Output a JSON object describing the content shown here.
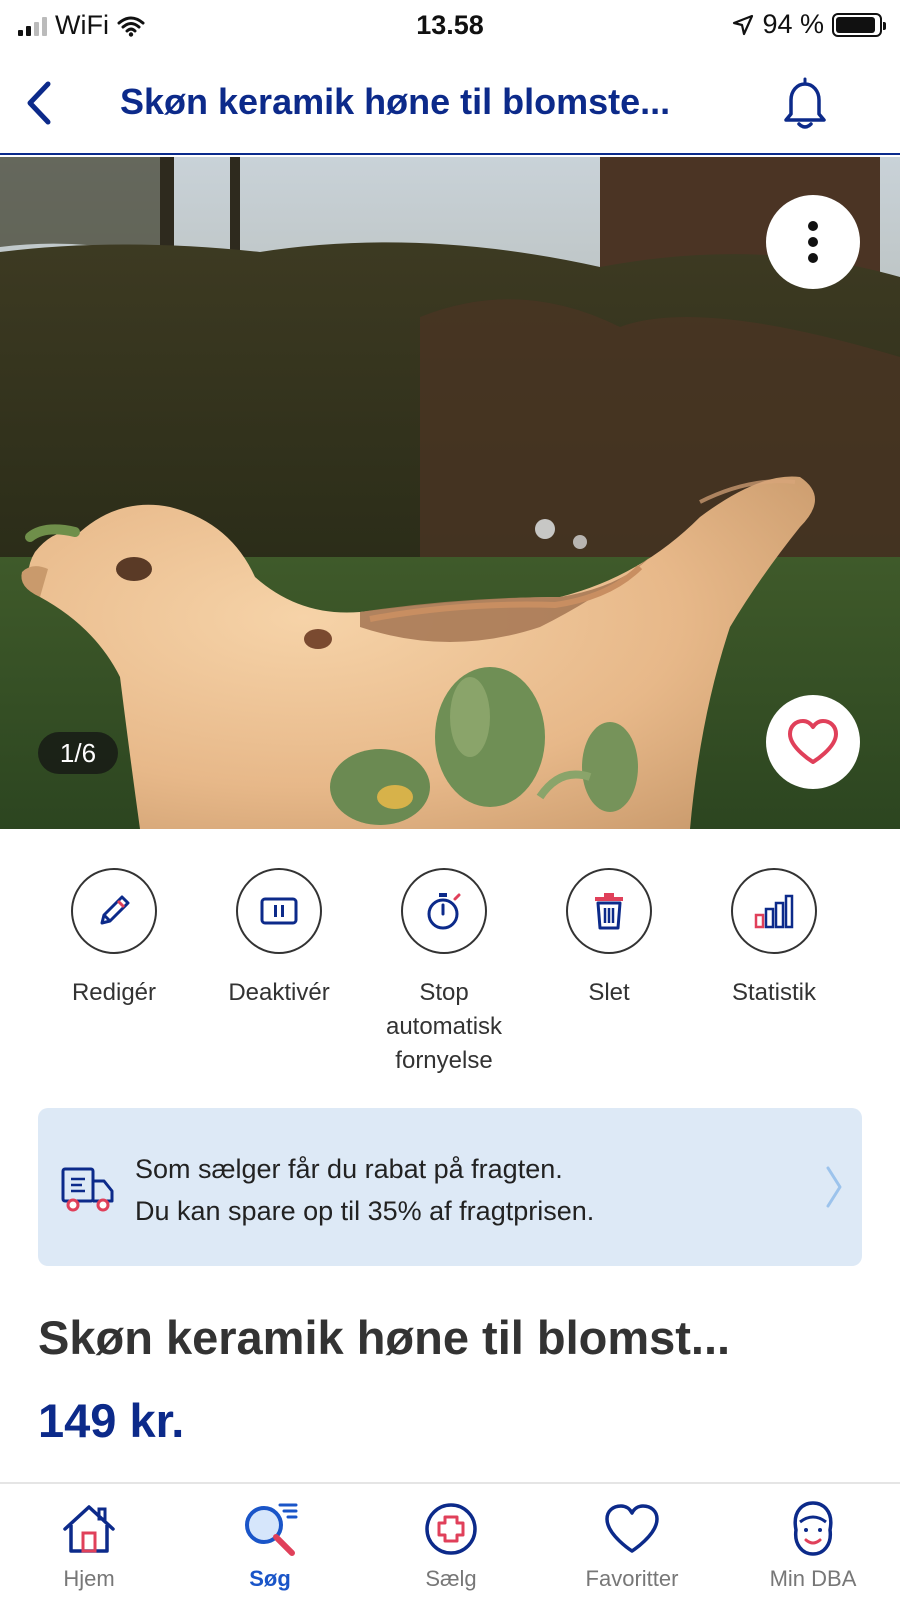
{
  "status_bar": {
    "carrier": "WiFi",
    "time": "13.58",
    "battery_text": "94 %",
    "battery_level": 0.94
  },
  "nav": {
    "title": "Skøn keramik høne til blomste..."
  },
  "gallery": {
    "counter": "1/6"
  },
  "actions": [
    {
      "label": "Redigér",
      "icon": "pencil-icon"
    },
    {
      "label": "Deaktivér",
      "icon": "pause-icon"
    },
    {
      "label": "Stop automatisk fornyelse",
      "icon": "stopwatch-icon"
    },
    {
      "label": "Slet",
      "icon": "trash-icon"
    },
    {
      "label": "Statistik",
      "icon": "bar-chart-icon"
    }
  ],
  "shipping_banner": {
    "line1": "Som sælger får du rabat på fragten.",
    "line2": "Du kan spare op til 35% af fragtprisen.",
    "icon": "delivery-truck-icon"
  },
  "listing": {
    "title": "Skøn keramik høne til blomst...",
    "price": "149 kr."
  },
  "tabbar": {
    "items": [
      {
        "label": "Hjem",
        "icon": "home-icon",
        "active": false
      },
      {
        "label": "Søg",
        "icon": "search-icon",
        "active": true
      },
      {
        "label": "Sælg",
        "icon": "plus-circle-icon",
        "active": false
      },
      {
        "label": "Favoritter",
        "icon": "heart-icon",
        "active": false
      },
      {
        "label": "Min DBA",
        "icon": "profile-icon",
        "active": false
      }
    ]
  },
  "colors": {
    "brand_navy": "#0c2a8a",
    "accent_blue": "#1a55c8",
    "favorite_red": "#e0405a",
    "banner_bg": "#dde9f6"
  }
}
